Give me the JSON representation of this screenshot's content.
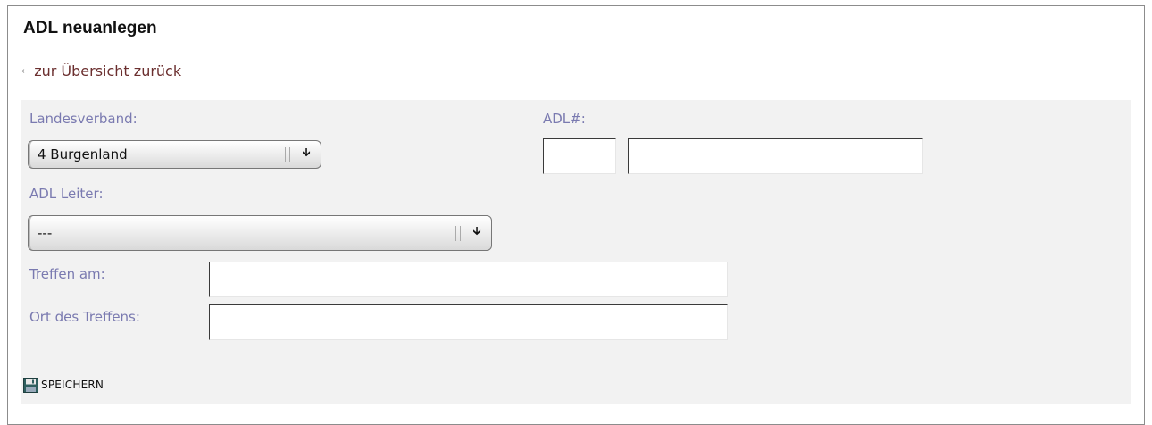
{
  "page": {
    "title": "ADL neuanlegen",
    "back_link": "zur Übersicht zurück"
  },
  "form": {
    "landesverband": {
      "label": "Landesverband:",
      "value": "4 Burgenland"
    },
    "adl_number": {
      "label": "ADL#:",
      "prefix_value": "",
      "number_value": ""
    },
    "adl_leiter": {
      "label": "ADL Leiter:",
      "value": "---"
    },
    "treffen_am": {
      "label": "Treffen am:",
      "value": ""
    },
    "ort": {
      "label": "Ort des Treffens:",
      "value": ""
    }
  },
  "actions": {
    "save_label": "SPEICHERN"
  },
  "icons": {
    "back": "arrow-left-icon",
    "dropdown": "dropdown-arrow-icon",
    "save": "floppy-disk-icon"
  },
  "colors": {
    "label": "#7a7ab0",
    "link": "#6b2f2f",
    "panel_bg": "#f2f2f2"
  }
}
